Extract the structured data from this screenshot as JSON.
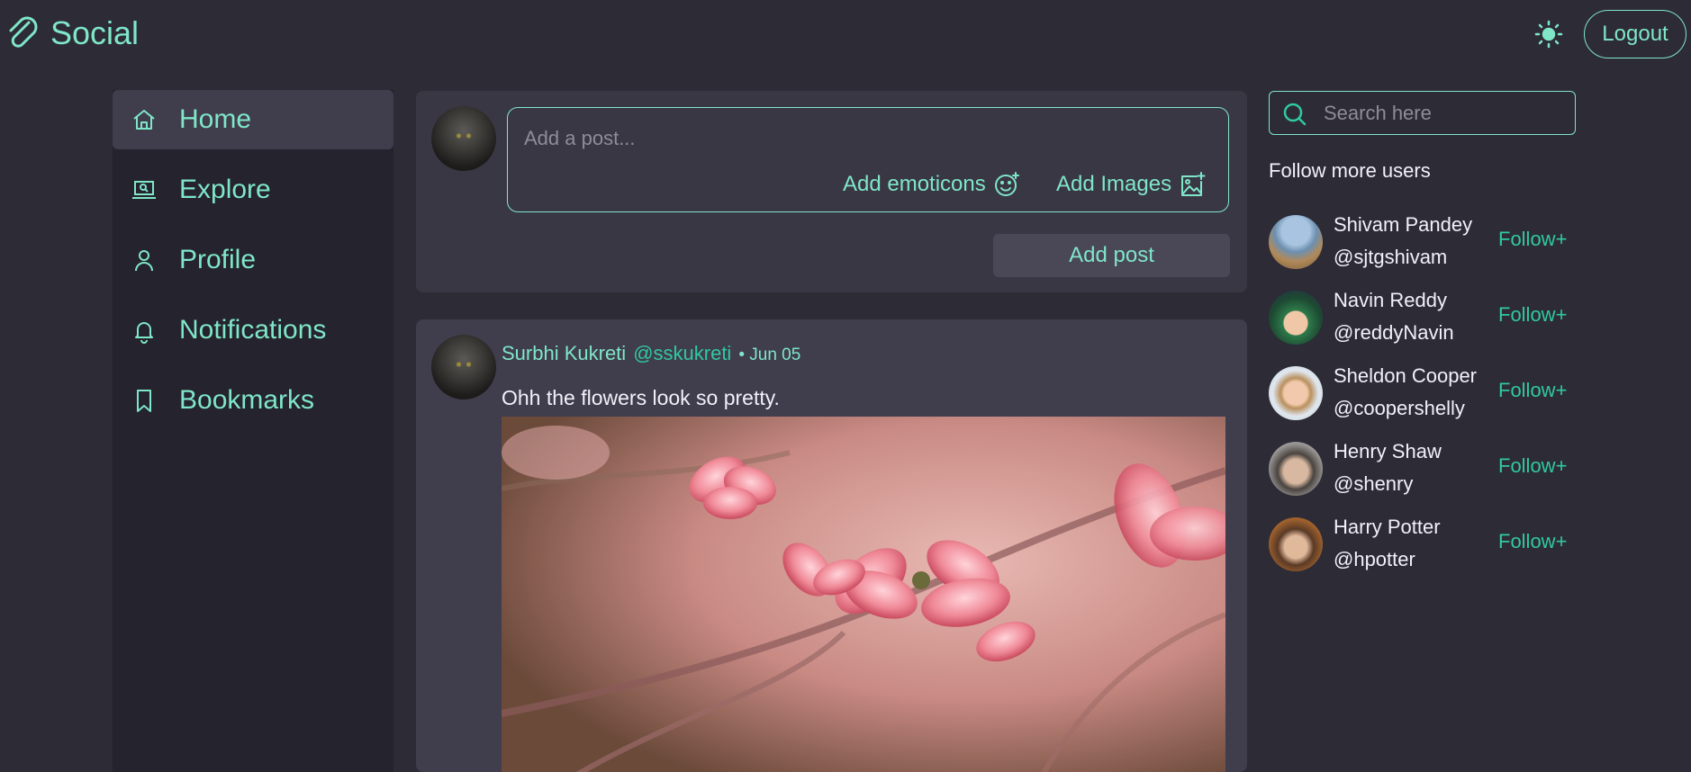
{
  "brand": {
    "name": "Social",
    "icon": "paperclip-icon"
  },
  "header": {
    "theme_icon": "sun-icon",
    "logout_label": "Logout"
  },
  "colors": {
    "accent": "#7fe6c8",
    "accent_strong": "#30c9a0",
    "background": "#2d2b36",
    "card": "#403d4d"
  },
  "sidebar": {
    "items": [
      {
        "label": "Home",
        "icon": "home-icon",
        "active": true
      },
      {
        "label": "Explore",
        "icon": "explore-icon",
        "active": false
      },
      {
        "label": "Profile",
        "icon": "profile-icon",
        "active": false
      },
      {
        "label": "Notifications",
        "icon": "bell-icon",
        "active": false
      },
      {
        "label": "Bookmarks",
        "icon": "bookmark-icon",
        "active": false
      }
    ]
  },
  "composer": {
    "placeholder": "Add a post...",
    "emoticons_label": "Add emoticons",
    "images_label": "Add Images",
    "submit_label": "Add post"
  },
  "feed": {
    "posts": [
      {
        "author": "Surbhi Kukreti",
        "handle": "@sskukreti",
        "date": "• Jun 05",
        "text": "Ohh the flowers look so pretty."
      }
    ]
  },
  "suggestions": {
    "search_placeholder": "Search here",
    "title": "Follow more users",
    "follow_label": "Follow+",
    "users": [
      {
        "name": "Shivam Pandey",
        "handle": "@sjtgshivam"
      },
      {
        "name": "Navin Reddy",
        "handle": "@reddyNavin"
      },
      {
        "name": "Sheldon Cooper",
        "handle": "@coopershelly"
      },
      {
        "name": "Henry Shaw",
        "handle": "@shenry"
      },
      {
        "name": "Harry Potter",
        "handle": "@hpotter"
      }
    ]
  }
}
